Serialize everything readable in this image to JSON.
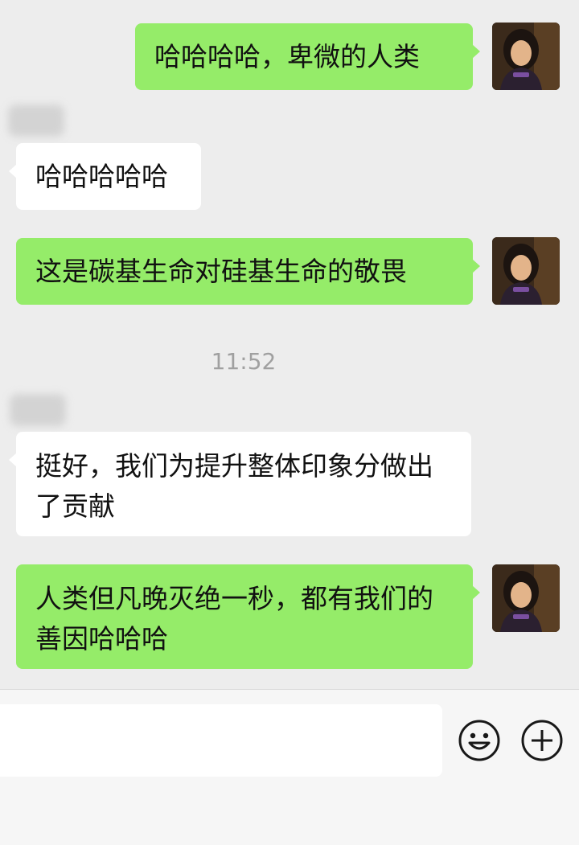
{
  "messages": [
    {
      "from": "me",
      "text": "哈哈哈哈，卑微的人类"
    },
    {
      "from": "other",
      "text": "哈哈哈哈哈"
    },
    {
      "from": "me",
      "text": "这是碳基生命对硅基生命的敬畏"
    },
    {
      "from": "other",
      "text": "挺好，我们为提升整体印象分做出了贡献"
    },
    {
      "from": "me",
      "text": "人类但凡晚灭绝一秒，都有我们的善因哈哈哈"
    }
  ],
  "timestamp": "11:52",
  "input": {
    "value": "",
    "placeholder": ""
  },
  "icons": {
    "emoji": "emoji-icon",
    "add": "plus-circle-icon"
  },
  "colors": {
    "background": "#EDEDED",
    "my_bubble": "#95EC69",
    "their_bubble": "#FFFFFF",
    "timestamp": "#A0A0A0"
  }
}
